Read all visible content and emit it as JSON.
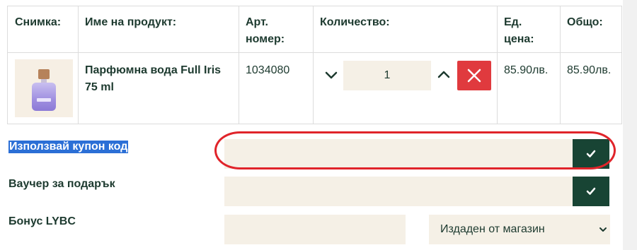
{
  "table": {
    "headers": {
      "image": "Снимка:",
      "name": "Име на продукт:",
      "sku_line1": "Арт.",
      "sku_line2": "номер:",
      "qty": "Количество:",
      "unit_line1": "Ед.",
      "unit_line2": "цена:",
      "total": "Общо:"
    },
    "row": {
      "name_line1": "Парфюмна вода Full Iris",
      "name_line2": "75 ml",
      "sku": "1034080",
      "qty": "1",
      "unit_price": "85.90лв.",
      "total": "85.90лв."
    }
  },
  "coupon": {
    "label": "Използвай купон код",
    "value": ""
  },
  "voucher": {
    "label": "Ваучер за подарък",
    "value": ""
  },
  "bonus": {
    "label": "Бонус LYBC",
    "value": "",
    "select_value": "Издаден от магазин"
  },
  "icons": {
    "qty_down": "chevron-down-icon",
    "qty_up": "chevron-up-icon",
    "delete": "close-icon",
    "apply": "checkmark-icon"
  },
  "colors": {
    "text": "#1d3a2f",
    "field_bg": "#f5f0e6",
    "apply_bg": "#184434",
    "delete_bg": "#e03a3e",
    "highlight": "#e0242a",
    "selection": "#2b6fd6"
  }
}
